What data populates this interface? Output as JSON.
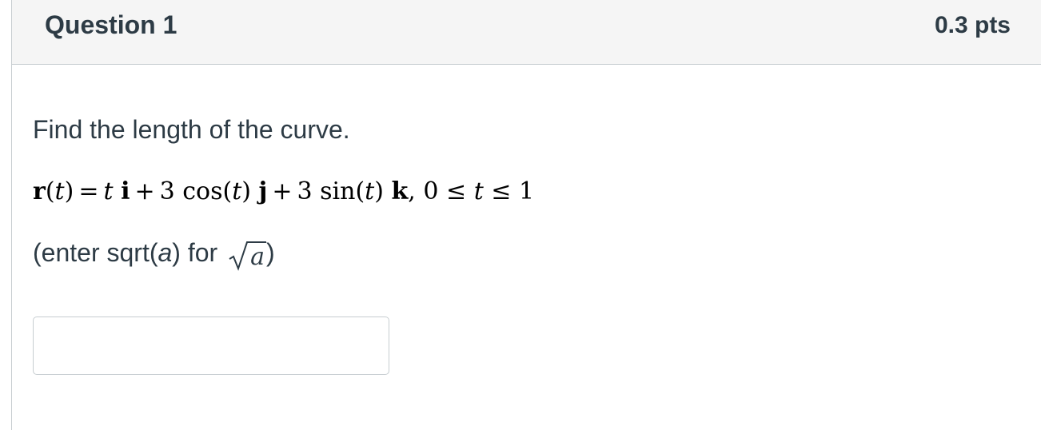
{
  "question": {
    "title": "Question 1",
    "points": "0.3 pts",
    "prompt": "Find the length of the curve.",
    "formula": {
      "r": "r",
      "t_paren": "(t)",
      "eq": "=",
      "t1": "t",
      "i": "i",
      "plus1": "+",
      "coef1": "3 cos(",
      "t2": "t",
      "close1": ")",
      "j": "j",
      "plus2": "+",
      "coef2": "3 sin(",
      "t3": "t",
      "close2": ")",
      "k": "k",
      "range": ", 0 ≤",
      "t4": "t",
      "range_end": "≤ 1"
    },
    "hint": {
      "prefix": "(enter sqrt(",
      "var": "a",
      "middle": ") for",
      "radicand": "a",
      "suffix": ")"
    },
    "answer": {
      "value": "",
      "placeholder": ""
    }
  }
}
